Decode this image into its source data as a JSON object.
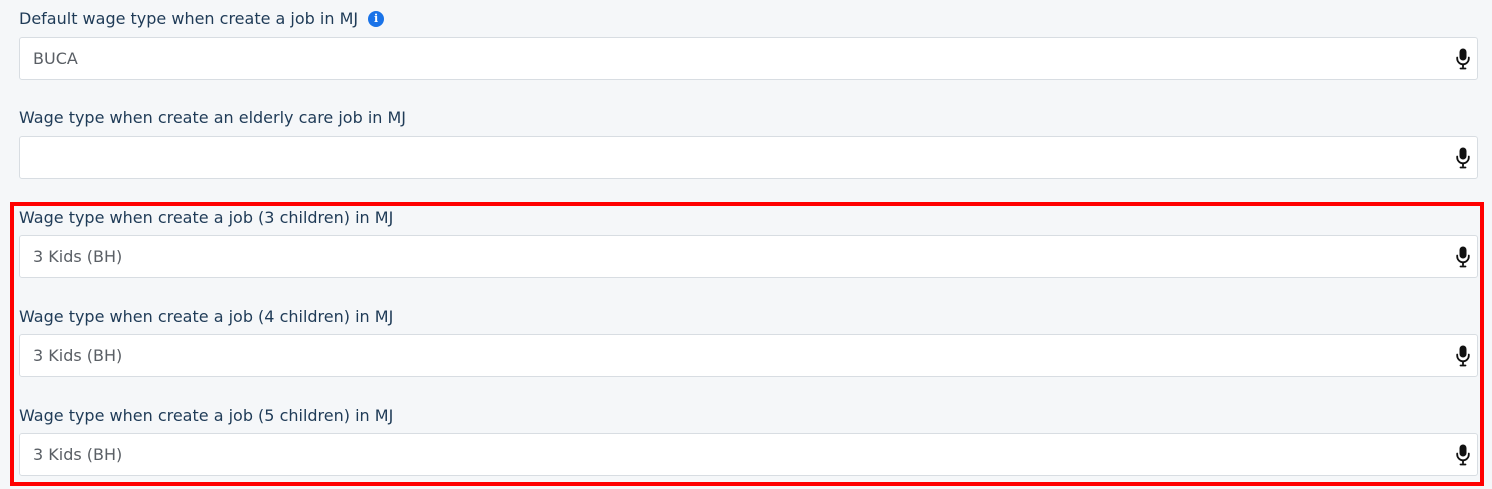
{
  "fields": [
    {
      "label": "Default wage type when create a job in MJ",
      "value": "BUCA",
      "has_info_icon": true
    },
    {
      "label": "Wage type when create an elderly care job in MJ",
      "value": ""
    },
    {
      "label": "Wage type when create a job (3 children) in MJ",
      "value": "3 Kids (BH)"
    },
    {
      "label": "Wage type when create a job (4 children) in MJ",
      "value": "3 Kids (BH)"
    },
    {
      "label": "Wage type when create a job (5 children) in MJ",
      "value": "3 Kids (BH)"
    }
  ],
  "info_icon_glyph": "i",
  "colors": {
    "label": "#1f3b57",
    "info_icon": "#1a73e8",
    "highlight_border": "#ff0000"
  }
}
